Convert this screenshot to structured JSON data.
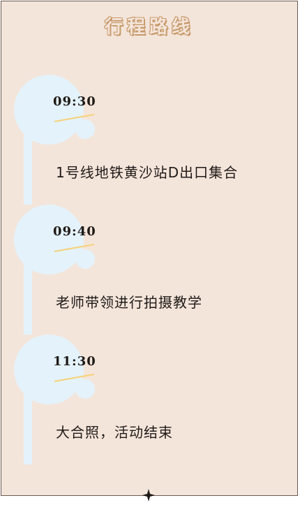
{
  "title": "行程路线",
  "steps": [
    {
      "time": "09:30",
      "text": "1号线地铁黄沙站D出口集合"
    },
    {
      "time": "09:40",
      "text": "老师带领进行拍摄教学"
    },
    {
      "time": "11:30",
      "text": "大合照，活动结束"
    }
  ],
  "colors": {
    "background": "#f4e5db",
    "circle": "#e4f2fb",
    "accent_line": "#f5d27a",
    "title_outline": "#c79a6a"
  },
  "icons": {
    "bottom_ornament": "four-point-star-icon"
  }
}
